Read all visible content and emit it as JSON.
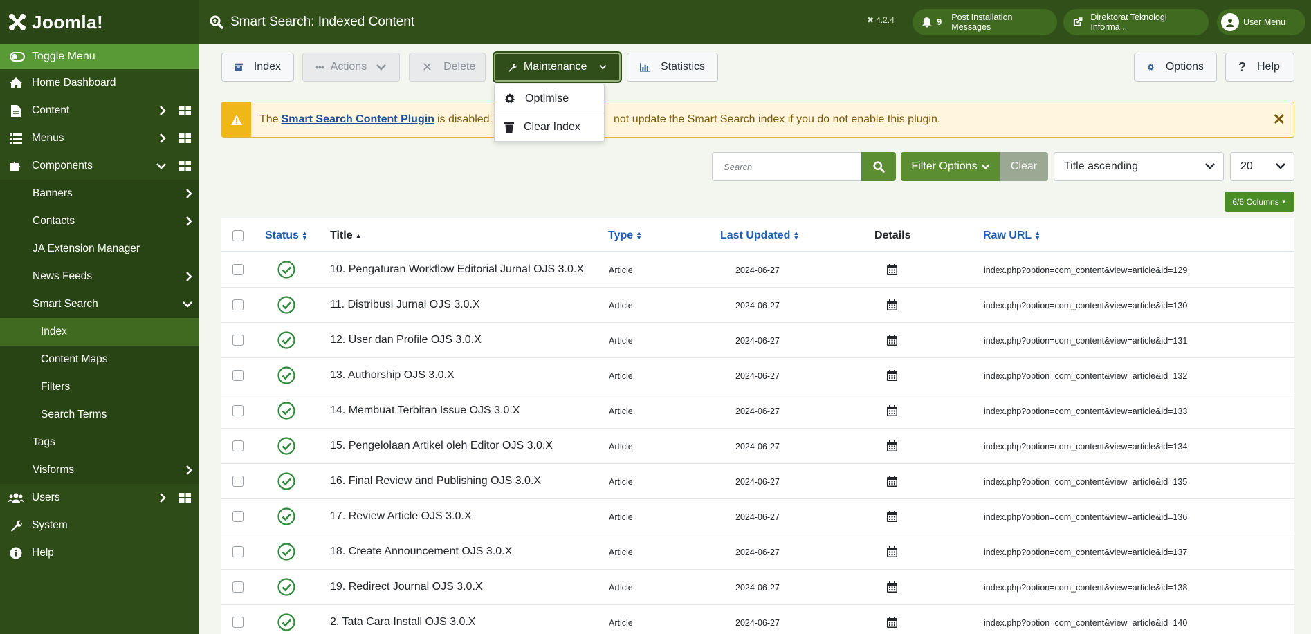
{
  "header": {
    "logo_text": "Joomla!",
    "page_title": "Smart Search: Indexed Content",
    "version": "4.2.4",
    "notif_count": "9",
    "post_install_label": "Post Installation Messages",
    "site_label": "Direktorat Teknologi Informa...",
    "user_menu_label": "User Menu"
  },
  "sidebar": {
    "toggle_label": "Toggle Menu",
    "home": "Home Dashboard",
    "content": "Content",
    "menus": "Menus",
    "components": "Components",
    "banners": "Banners",
    "contacts": "Contacts",
    "ja_ext": "JA Extension Manager",
    "news_feeds": "News Feeds",
    "smart_search": "Smart Search",
    "index": "Index",
    "content_maps": "Content Maps",
    "filters": "Filters",
    "search_terms": "Search Terms",
    "tags": "Tags",
    "visforms": "Visforms",
    "users": "Users",
    "system": "System",
    "help": "Help"
  },
  "toolbar": {
    "index": "Index",
    "actions": "Actions",
    "delete": "Delete",
    "maintenance": "Maintenance",
    "statistics": "Statistics",
    "options": "Options",
    "help": "Help"
  },
  "maintenance_menu": {
    "optimise": "Optimise",
    "clear_index": "Clear Index"
  },
  "alert": {
    "prefix": "The",
    "link": "Smart Search Content Plugin",
    "mid": "is disabled. C",
    "suffix": "not update the Smart Search index if you do not enable this plugin."
  },
  "filters": {
    "search_placeholder": "Search",
    "filter_options": "Filter Options",
    "clear": "Clear",
    "ordering": "Title ascending",
    "limit": "20",
    "columns": "6/6 Columns"
  },
  "table": {
    "headers": {
      "status": "Status",
      "title": "Title",
      "type": "Type",
      "last_updated": "Last Updated",
      "details": "Details",
      "raw_url": "Raw URL"
    },
    "rows": [
      {
        "title": "10. Pengaturan Workflow Editorial Jurnal OJS 3.0.X",
        "type": "Article",
        "date": "2024-06-27",
        "url": "index.php?option=com_content&view=article&id=129"
      },
      {
        "title": "11. Distribusi Jurnal OJS 3.0.X",
        "type": "Article",
        "date": "2024-06-27",
        "url": "index.php?option=com_content&view=article&id=130"
      },
      {
        "title": "12. User dan Profile OJS 3.0.X",
        "type": "Article",
        "date": "2024-06-27",
        "url": "index.php?option=com_content&view=article&id=131"
      },
      {
        "title": "13. Authorship OJS 3.0.X",
        "type": "Article",
        "date": "2024-06-27",
        "url": "index.php?option=com_content&view=article&id=132"
      },
      {
        "title": "14. Membuat Terbitan Issue OJS 3.0.X",
        "type": "Article",
        "date": "2024-06-27",
        "url": "index.php?option=com_content&view=article&id=133"
      },
      {
        "title": "15. Pengelolaan Artikel oleh Editor OJS 3.0.X",
        "type": "Article",
        "date": "2024-06-27",
        "url": "index.php?option=com_content&view=article&id=134"
      },
      {
        "title": "16. Final Review and Publishing OJS 3.0.X",
        "type": "Article",
        "date": "2024-06-27",
        "url": "index.php?option=com_content&view=article&id=135"
      },
      {
        "title": "17. Review Article OJS 3.0.X",
        "type": "Article",
        "date": "2024-06-27",
        "url": "index.php?option=com_content&view=article&id=136"
      },
      {
        "title": "18. Create Announcement OJS 3.0.X",
        "type": "Article",
        "date": "2024-06-27",
        "url": "index.php?option=com_content&view=article&id=137"
      },
      {
        "title": "19. Redirect Journal OJS 3.0.X",
        "type": "Article",
        "date": "2024-06-27",
        "url": "index.php?option=com_content&view=article&id=138"
      },
      {
        "title": "2. Tata Cara Install OJS 3.0.X",
        "type": "Article",
        "date": "2024-06-27",
        "url": "index.php?option=com_content&view=article&id=140"
      }
    ]
  },
  "colors": {
    "header_bg": "#315019",
    "sidebar_bg": "#2e4c17",
    "accent_green": "#5b8e32",
    "status_green": "#2f8a3a",
    "link_blue": "#1f5fb3"
  }
}
